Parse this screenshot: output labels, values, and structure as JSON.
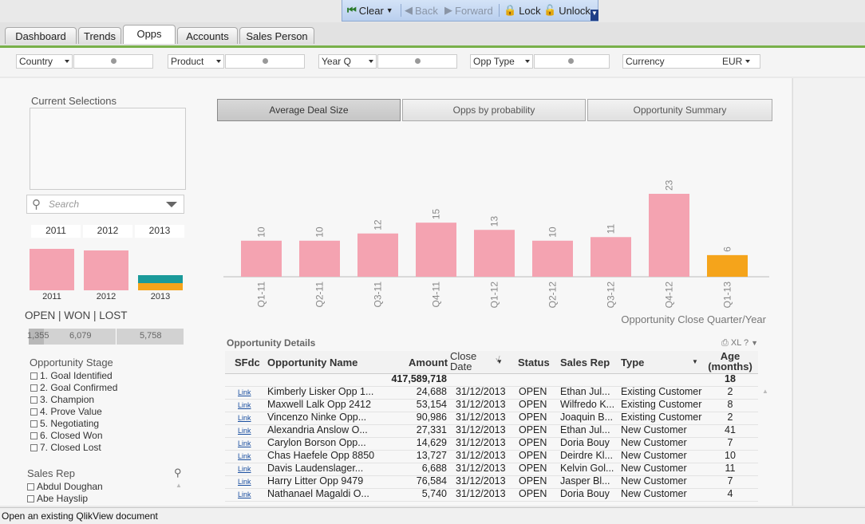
{
  "toolbar": {
    "clear": "Clear",
    "back": "Back",
    "forward": "Forward",
    "lock": "Lock",
    "unlock": "Unlock"
  },
  "tabs": [
    "Dashboard",
    "Trends",
    "Opps",
    "Accounts",
    "Sales Person"
  ],
  "filters": {
    "country": "Country",
    "product": "Product",
    "yearq": "Year Q",
    "opptype": "Opp Type",
    "currency_label": "Currency",
    "currency_value": "EUR"
  },
  "current_selections": {
    "title": "Current Selections"
  },
  "search": {
    "placeholder": "Search"
  },
  "years": {
    "labels": [
      "2011",
      "2012",
      "2013"
    ],
    "bars": [
      {
        "label": "2011",
        "color": "#f4a3b1"
      },
      {
        "label": "2012",
        "color": "#f4a3b1"
      },
      {
        "label": "2013",
        "colors": [
          "#1b9a9a",
          "#f5a41b"
        ]
      }
    ]
  },
  "owl": {
    "title": "OPEN | WON | LOST",
    "values": [
      "1,355",
      "6,079",
      "5,758"
    ]
  },
  "opportunity_stage": {
    "title": "Opportunity Stage",
    "items": [
      "1. Goal Identified",
      "2. Goal Confirmed",
      "3. Champion",
      "4. Prove Value",
      "5. Negotiating",
      "6. Closed Won",
      "7. Closed Lost"
    ]
  },
  "sales_rep": {
    "title": "Sales Rep",
    "items": [
      "Abdul  Doughan",
      "Abe  Hayslip"
    ]
  },
  "chart_buttons": [
    "Average Deal Size",
    "Opps by probability",
    "Opportunity Summary"
  ],
  "chart_data": {
    "type": "bar",
    "categories": [
      "Q1-11",
      "Q2-11",
      "Q3-11",
      "Q4-11",
      "Q1-12",
      "Q2-12",
      "Q3-12",
      "Q4-12",
      "Q1-13"
    ],
    "values": [
      10,
      10,
      12,
      15,
      13,
      10,
      11,
      23,
      6
    ],
    "colors": [
      "#f4a3b1",
      "#f4a3b1",
      "#f4a3b1",
      "#f4a3b1",
      "#f4a3b1",
      "#f4a3b1",
      "#f4a3b1",
      "#f4a3b1",
      "#f5a41b"
    ],
    "xlabel": "Opportunity Close Quarter/Year",
    "ylim": [
      0,
      25
    ]
  },
  "table": {
    "title": "Opportunity Details",
    "icons_text": "XL ?",
    "headers": {
      "sfdc": "SFdc",
      "name": "Opportunity Name",
      "amount": "Amount",
      "close": "Close Date",
      "status": "Status",
      "rep": "Sales Rep",
      "type": "Type",
      "age": "Age (months)"
    },
    "totals": {
      "amount": "417,589,718",
      "age": "18"
    },
    "rows": [
      {
        "link": "Link",
        "name": "Kimberly  Lisker Opp 1...",
        "amount": "24,688",
        "close": "31/12/2013",
        "status": "OPEN",
        "rep": "Ethan  Jul...",
        "type": "Existing Customer",
        "age": "2"
      },
      {
        "link": "Link",
        "name": "Maxwell  Lalk Opp 2412",
        "amount": "53,154",
        "close": "31/12/2013",
        "status": "OPEN",
        "rep": "Wilfredo  K...",
        "type": "Existing Customer",
        "age": "8"
      },
      {
        "link": "Link",
        "name": "Vincenzo  Ninke Opp...",
        "amount": "90,986",
        "close": "31/12/2013",
        "status": "OPEN",
        "rep": "Joaquin  B...",
        "type": "Existing Customer",
        "age": "2"
      },
      {
        "link": "Link",
        "name": "Alexandria  Anslow O...",
        "amount": "27,331",
        "close": "31/12/2013",
        "status": "OPEN",
        "rep": "Ethan  Jul...",
        "type": "New Customer",
        "age": "41"
      },
      {
        "link": "Link",
        "name": "Carylon  Borson Opp...",
        "amount": "14,629",
        "close": "31/12/2013",
        "status": "OPEN",
        "rep": "Doria  Bouy",
        "type": "New Customer",
        "age": "7"
      },
      {
        "link": "Link",
        "name": "Chas  Haefele Opp 8850",
        "amount": "13,727",
        "close": "31/12/2013",
        "status": "OPEN",
        "rep": "Deirdre  Kl...",
        "type": "New Customer",
        "age": "10"
      },
      {
        "link": "Link",
        "name": "Davis  Laudenslager...",
        "amount": "6,688",
        "close": "31/12/2013",
        "status": "OPEN",
        "rep": "Kelvin  Gol...",
        "type": "New Customer",
        "age": "11"
      },
      {
        "link": "Link",
        "name": "Harry  Litter Opp 9479",
        "amount": "76,584",
        "close": "31/12/2013",
        "status": "OPEN",
        "rep": "Jasper  Bl...",
        "type": "New Customer",
        "age": "7"
      },
      {
        "link": "Link",
        "name": "Nathanael  Magaldi O...",
        "amount": "5,740",
        "close": "31/12/2013",
        "status": "OPEN",
        "rep": "Doria  Bouy",
        "type": "New Customer",
        "age": "4"
      }
    ]
  },
  "statusbar": "Open an existing QlikView document"
}
